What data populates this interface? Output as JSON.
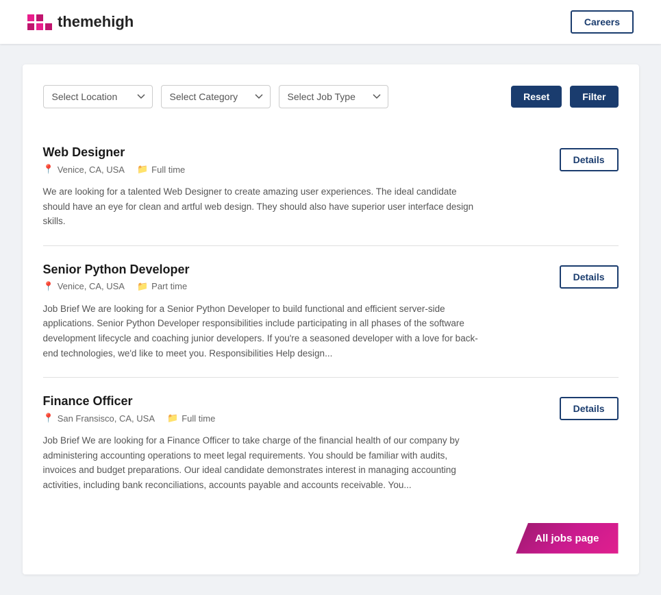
{
  "header": {
    "logo_text": "themehigh",
    "careers_label": "Careers"
  },
  "filters": {
    "location_placeholder": "Select Location",
    "category_placeholder": "Select Category",
    "jobtype_placeholder": "Select Job Type",
    "reset_label": "Reset",
    "filter_label": "Filter"
  },
  "jobs": [
    {
      "id": 1,
      "title": "Web Designer",
      "location": "Venice, CA, USA",
      "job_type": "Full time",
      "description": "We are looking for a talented Web Designer to create amazing user experiences. The ideal candidate should have an eye for clean and artful web design. They should also have superior user interface design skills.",
      "details_label": "Details"
    },
    {
      "id": 2,
      "title": "Senior Python Developer",
      "location": "Venice, CA, USA",
      "job_type": "Part time",
      "description": "Job Brief We are looking for a Senior Python Developer to build functional and efficient server-side applications. Senior Python Developer responsibilities include participating in all phases of the software development lifecycle and coaching junior developers. If you're a seasoned developer with a love for back-end technologies, we'd like to meet you.  Responsibilities Help design...",
      "details_label": "Details"
    },
    {
      "id": 3,
      "title": "Finance Officer",
      "location": "San Fransisco, CA, USA",
      "job_type": "Full time",
      "description": "Job Brief We are looking for a Finance Officer to take charge of the financial health of our company by administering accounting operations to meet legal requirements. You should be familiar with audits, invoices and budget preparations. Our ideal candidate demonstrates interest in managing accounting activities, including bank reconciliations, accounts payable and accounts receivable. You...",
      "details_label": "Details"
    }
  ],
  "all_jobs_label": "All jobs page"
}
